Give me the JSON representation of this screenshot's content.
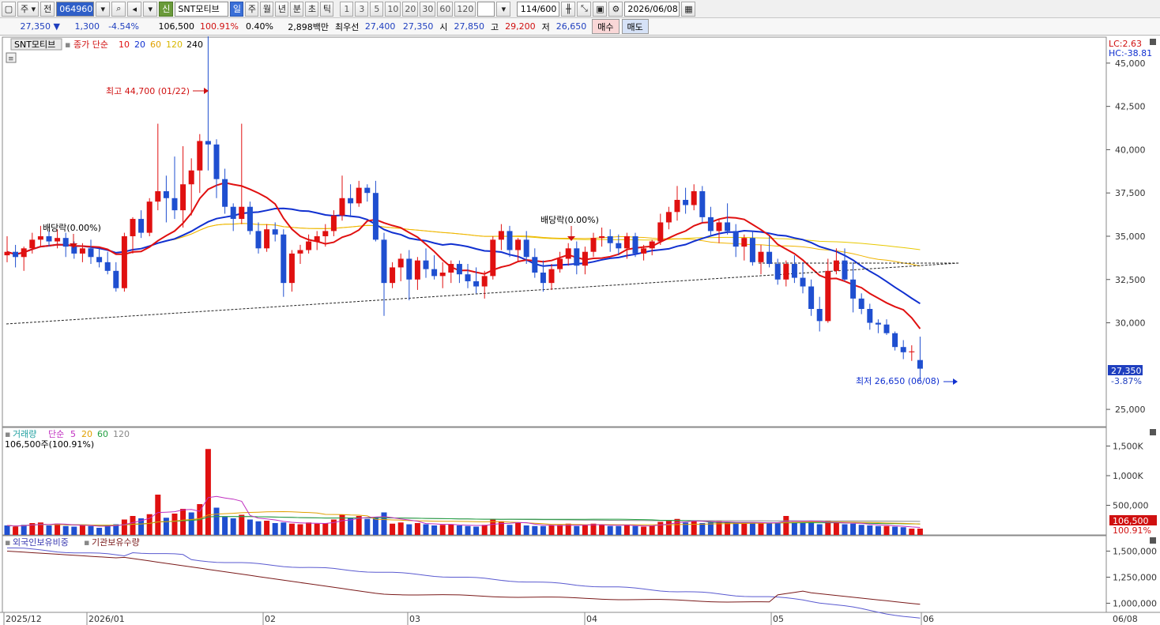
{
  "toolbar": {
    "type_label": "주",
    "prev_label": "전",
    "code": "064960",
    "new_badge": "신",
    "name": "SNT모티브",
    "periods": [
      "일",
      "주",
      "월",
      "년",
      "분",
      "초",
      "틱"
    ],
    "active_period": "일",
    "intervals": [
      "1",
      "3",
      "5",
      "10",
      "20",
      "30",
      "60",
      "120"
    ],
    "count": "114",
    "count_total": "/600",
    "date": "2026/06/08"
  },
  "quote": {
    "price": "27,350",
    "change": "1,300",
    "change_rate": "-4.54%",
    "volume": "106,500",
    "volume_rate": "100.91%",
    "turnover": "0.40%",
    "amount": "2,898백만",
    "bid_label": "최우선",
    "ask_price": "27,400",
    "bid_price": "27,350",
    "open_label": "시",
    "open": "27,850",
    "high_label": "고",
    "high": "29,200",
    "low_label": "저",
    "low": "26,650",
    "buy_label": "매수",
    "sell_label": "매도"
  },
  "price_panel": {
    "stock_label": "SNT모티브",
    "ma_title": "종가 단순",
    "ma_periods": [
      "10",
      "20",
      "60",
      "120",
      "240"
    ],
    "ma_colors": [
      "#e01010",
      "#1030d0",
      "#f0b400",
      "#e8c800",
      "#000000"
    ],
    "lc": "LC:2.63",
    "hc": "HC:-38.81",
    "y_ticks": [
      "45,000",
      "42,500",
      "40,000",
      "37,500",
      "35,000",
      "32,500",
      "30,000",
      "27,500",
      "25,000"
    ],
    "last_price": "27,350",
    "last_rate": "-3.87%",
    "high_annotation": "최고 44,700 (01/22)",
    "low_annotation": "최저 26,650 (06/08)",
    "div1": "배당락(0.00%)",
    "div2": "배당락(0.00%)"
  },
  "volume_panel": {
    "title": "거래량",
    "ma_title": "단순",
    "ma_periods": [
      "5",
      "20",
      "60",
      "120"
    ],
    "ma_colors": [
      "#c030c0",
      "#e0a000",
      "#20a040",
      "#888888"
    ],
    "info": "106,500주(100.91%)",
    "y_ticks": [
      "1,500K",
      "1,000K",
      "500,000"
    ],
    "last_volume": "106,500",
    "last_rate": "100.91%"
  },
  "foreign_panel": {
    "series1": "외국인보유비중",
    "series2": "기관보유수량",
    "y_ticks": [
      "1,500,000",
      "1,250,000",
      "1,000,000"
    ]
  },
  "x_axis": {
    "labels": [
      "2025/12",
      "2026/01",
      "02",
      "03",
      "04",
      "05",
      "06"
    ],
    "right_label": "06/08"
  },
  "chart_data": {
    "type": "candlestick",
    "ylim": [
      24000,
      46500
    ],
    "candles": [
      [
        33900,
        35000,
        33500,
        34100
      ],
      [
        34100,
        34500,
        33200,
        33800
      ],
      [
        33800,
        34400,
        33000,
        34300
      ],
      [
        34300,
        35200,
        34000,
        34800
      ],
      [
        34800,
        35600,
        34400,
        35000
      ],
      [
        35000,
        35300,
        34400,
        34700
      ],
      [
        34700,
        35400,
        34300,
        34900
      ],
      [
        34900,
        35200,
        33800,
        34400
      ],
      [
        34400,
        34700,
        33700,
        34000
      ],
      [
        34000,
        34600,
        33500,
        34300
      ],
      [
        34300,
        34800,
        33400,
        33800
      ],
      [
        33800,
        34300,
        33200,
        33500
      ],
      [
        33500,
        34100,
        32800,
        33000
      ],
      [
        33000,
        33500,
        31800,
        32000
      ],
      [
        32000,
        35200,
        31800,
        35000
      ],
      [
        35000,
        36100,
        34000,
        36000
      ],
      [
        36000,
        36500,
        34900,
        35200
      ],
      [
        35200,
        37200,
        35000,
        37000
      ],
      [
        37000,
        41500,
        36500,
        37600
      ],
      [
        37600,
        38500,
        35800,
        37200
      ],
      [
        37200,
        39600,
        36000,
        36500
      ],
      [
        36500,
        40200,
        35500,
        38000
      ],
      [
        38000,
        39500,
        36200,
        38800
      ],
      [
        38800,
        40900,
        37500,
        40500
      ],
      [
        40500,
        46700,
        38800,
        40300
      ],
      [
        40300,
        40600,
        37200,
        38300
      ],
      [
        38300,
        38900,
        36300,
        36700
      ],
      [
        36700,
        36900,
        35300,
        36000
      ],
      [
        36000,
        41500,
        35700,
        36700
      ],
      [
        36700,
        37000,
        35100,
        35300
      ],
      [
        35300,
        35800,
        34000,
        34300
      ],
      [
        34300,
        35700,
        34100,
        35400
      ],
      [
        35400,
        35800,
        34700,
        35100
      ],
      [
        35100,
        35400,
        31500,
        32300
      ],
      [
        32300,
        34200,
        31800,
        34000
      ],
      [
        34000,
        34500,
        33400,
        34200
      ],
      [
        34200,
        35100,
        34000,
        34700
      ],
      [
        34700,
        35300,
        34200,
        35000
      ],
      [
        35000,
        35700,
        34400,
        35300
      ],
      [
        35300,
        36500,
        35000,
        36200
      ],
      [
        36200,
        38500,
        35900,
        37200
      ],
      [
        37200,
        38000,
        36100,
        36900
      ],
      [
        36900,
        38200,
        36700,
        37800
      ],
      [
        37800,
        38000,
        37000,
        37500
      ],
      [
        37500,
        38200,
        34700,
        34800
      ],
      [
        34800,
        35200,
        30400,
        32300
      ],
      [
        32300,
        33500,
        32000,
        33200
      ],
      [
        33200,
        34000,
        32400,
        33700
      ],
      [
        33700,
        34200,
        31300,
        32500
      ],
      [
        32500,
        33800,
        31900,
        33600
      ],
      [
        33600,
        34300,
        32600,
        33100
      ],
      [
        33100,
        33900,
        32500,
        32700
      ],
      [
        32700,
        33500,
        32000,
        32900
      ],
      [
        32900,
        33600,
        32300,
        33400
      ],
      [
        33400,
        33600,
        32300,
        32800
      ],
      [
        32800,
        33400,
        32000,
        32400
      ],
      [
        32400,
        33200,
        31700,
        32100
      ],
      [
        32100,
        33000,
        31400,
        32700
      ],
      [
        32700,
        35000,
        32500,
        34800
      ],
      [
        34800,
        35700,
        34200,
        35300
      ],
      [
        35300,
        35600,
        33800,
        34200
      ],
      [
        34200,
        34900,
        33500,
        34800
      ],
      [
        34800,
        35300,
        33400,
        33800
      ],
      [
        33800,
        34300,
        32600,
        32900
      ],
      [
        32900,
        33600,
        31800,
        32300
      ],
      [
        32300,
        33400,
        31900,
        33100
      ],
      [
        33100,
        34100,
        32900,
        33700
      ],
      [
        33700,
        34600,
        33300,
        34300
      ],
      [
        34300,
        34700,
        32800,
        33300
      ],
      [
        33300,
        34400,
        32800,
        34100
      ],
      [
        34100,
        35200,
        33800,
        34900
      ],
      [
        34900,
        35500,
        34400,
        35000
      ],
      [
        35000,
        35400,
        34100,
        34600
      ],
      [
        34600,
        35100,
        33900,
        34300
      ],
      [
        34300,
        35200,
        33700,
        35000
      ],
      [
        35000,
        35200,
        33800,
        34000
      ],
      [
        34000,
        34500,
        33600,
        34300
      ],
      [
        34300,
        34800,
        33900,
        34700
      ],
      [
        34700,
        36300,
        34500,
        35800
      ],
      [
        35800,
        36700,
        35400,
        36400
      ],
      [
        36400,
        37900,
        35900,
        37100
      ],
      [
        37100,
        37800,
        36300,
        36800
      ],
      [
        36800,
        38000,
        36500,
        37600
      ],
      [
        37600,
        37900,
        35800,
        36100
      ],
      [
        36100,
        36700,
        35000,
        35300
      ],
      [
        35300,
        36000,
        34600,
        35800
      ],
      [
        35800,
        36900,
        35100,
        35300
      ],
      [
        35300,
        35700,
        33800,
        34400
      ],
      [
        34400,
        35100,
        33600,
        34900
      ],
      [
        34900,
        35300,
        33300,
        33500
      ],
      [
        33500,
        34500,
        32800,
        34100
      ],
      [
        34100,
        35000,
        33200,
        33400
      ],
      [
        33400,
        33700,
        32200,
        32500
      ],
      [
        32500,
        33600,
        32100,
        33400
      ],
      [
        33400,
        33900,
        32300,
        32600
      ],
      [
        32600,
        33500,
        31700,
        32100
      ],
      [
        32100,
        32500,
        30400,
        30800
      ],
      [
        30800,
        31500,
        29500,
        30100
      ],
      [
        30100,
        33700,
        30000,
        33000
      ],
      [
        33000,
        34300,
        32800,
        33600
      ],
      [
        33600,
        34300,
        32400,
        32500
      ],
      [
        32500,
        33500,
        30600,
        31400
      ],
      [
        31400,
        31700,
        30500,
        30800
      ],
      [
        30800,
        31100,
        29600,
        30000
      ],
      [
        30000,
        30200,
        29400,
        29900
      ],
      [
        29900,
        30200,
        29300,
        29400
      ],
      [
        29400,
        29500,
        28400,
        28600
      ],
      [
        28600,
        29000,
        27900,
        28300
      ],
      [
        28300,
        28700,
        27800,
        28350
      ],
      [
        27850,
        29200,
        26650,
        27350
      ]
    ],
    "volumes": [
      [
        160,
        "blue"
      ],
      [
        140,
        "red"
      ],
      [
        170,
        "blue"
      ],
      [
        200,
        "red"
      ],
      [
        210,
        "red"
      ],
      [
        160,
        "blue"
      ],
      [
        190,
        "red"
      ],
      [
        150,
        "blue"
      ],
      [
        140,
        "blue"
      ],
      [
        170,
        "red"
      ],
      [
        150,
        "blue"
      ],
      [
        120,
        "blue"
      ],
      [
        160,
        "blue"
      ],
      [
        180,
        "blue"
      ],
      [
        260,
        "red"
      ],
      [
        320,
        "red"
      ],
      [
        280,
        "blue"
      ],
      [
        350,
        "red"
      ],
      [
        680,
        "red"
      ],
      [
        290,
        "blue"
      ],
      [
        360,
        "red"
      ],
      [
        440,
        "red"
      ],
      [
        380,
        "blue"
      ],
      [
        520,
        "red"
      ],
      [
        1450,
        "red"
      ],
      [
        460,
        "blue"
      ],
      [
        310,
        "blue"
      ],
      [
        280,
        "blue"
      ],
      [
        340,
        "red"
      ],
      [
        260,
        "blue"
      ],
      [
        230,
        "blue"
      ],
      [
        240,
        "red"
      ],
      [
        200,
        "blue"
      ],
      [
        210,
        "blue"
      ],
      [
        190,
        "red"
      ],
      [
        180,
        "red"
      ],
      [
        210,
        "red"
      ],
      [
        190,
        "red"
      ],
      [
        200,
        "red"
      ],
      [
        260,
        "red"
      ],
      [
        340,
        "red"
      ],
      [
        280,
        "blue"
      ],
      [
        320,
        "red"
      ],
      [
        270,
        "blue"
      ],
      [
        300,
        "blue"
      ],
      [
        380,
        "blue"
      ],
      [
        190,
        "red"
      ],
      [
        210,
        "red"
      ],
      [
        180,
        "blue"
      ],
      [
        200,
        "red"
      ],
      [
        180,
        "blue"
      ],
      [
        160,
        "blue"
      ],
      [
        170,
        "red"
      ],
      [
        180,
        "red"
      ],
      [
        160,
        "blue"
      ],
      [
        150,
        "blue"
      ],
      [
        140,
        "blue"
      ],
      [
        170,
        "red"
      ],
      [
        270,
        "red"
      ],
      [
        230,
        "red"
      ],
      [
        170,
        "blue"
      ],
      [
        200,
        "red"
      ],
      [
        160,
        "blue"
      ],
      [
        150,
        "blue"
      ],
      [
        150,
        "blue"
      ],
      [
        160,
        "red"
      ],
      [
        170,
        "red"
      ],
      [
        190,
        "red"
      ],
      [
        150,
        "blue"
      ],
      [
        160,
        "red"
      ],
      [
        190,
        "red"
      ],
      [
        170,
        "red"
      ],
      [
        150,
        "blue"
      ],
      [
        150,
        "blue"
      ],
      [
        170,
        "red"
      ],
      [
        150,
        "blue"
      ],
      [
        140,
        "red"
      ],
      [
        160,
        "red"
      ],
      [
        220,
        "red"
      ],
      [
        240,
        "red"
      ],
      [
        270,
        "red"
      ],
      [
        210,
        "blue"
      ],
      [
        240,
        "red"
      ],
      [
        200,
        "blue"
      ],
      [
        210,
        "blue"
      ],
      [
        230,
        "red"
      ],
      [
        220,
        "red"
      ],
      [
        200,
        "blue"
      ],
      [
        200,
        "red"
      ],
      [
        210,
        "blue"
      ],
      [
        210,
        "red"
      ],
      [
        200,
        "blue"
      ],
      [
        210,
        "blue"
      ],
      [
        320,
        "red"
      ],
      [
        220,
        "blue"
      ],
      [
        210,
        "blue"
      ],
      [
        220,
        "blue"
      ],
      [
        180,
        "blue"
      ],
      [
        240,
        "red"
      ],
      [
        200,
        "red"
      ],
      [
        180,
        "blue"
      ],
      [
        190,
        "blue"
      ],
      [
        170,
        "blue"
      ],
      [
        160,
        "blue"
      ],
      [
        150,
        "blue"
      ],
      [
        150,
        "red"
      ],
      [
        140,
        "blue"
      ],
      [
        130,
        "blue"
      ],
      [
        106,
        "red"
      ],
      [
        107,
        "red"
      ]
    ]
  }
}
